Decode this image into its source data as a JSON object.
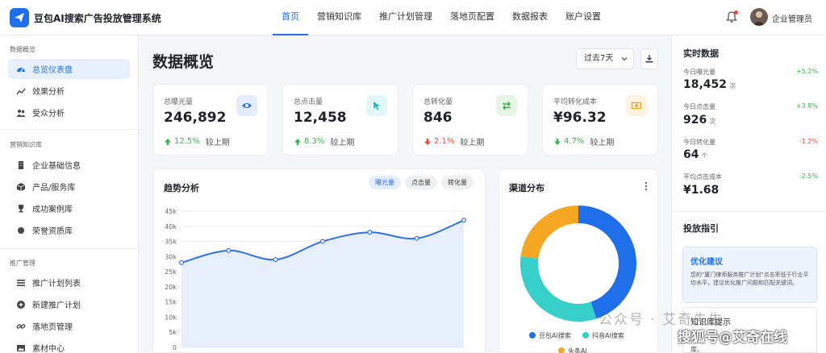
{
  "app": {
    "title": "豆包AI搜索广告投放管理系统"
  },
  "nav": [
    {
      "label": "首页"
    },
    {
      "label": "营销知识库"
    },
    {
      "label": "推广计划管理"
    },
    {
      "label": "落地页配置"
    },
    {
      "label": "数据报表"
    },
    {
      "label": "账户设置"
    }
  ],
  "user": {
    "name": "企业管理员"
  },
  "sidebar": {
    "sections": [
      {
        "title": "数据概览",
        "items": [
          {
            "label": "总览仪表盘",
            "icon": "dashboard-icon"
          },
          {
            "label": "效果分析",
            "icon": "line-chart-icon"
          },
          {
            "label": "受众分析",
            "icon": "users-icon"
          }
        ]
      },
      {
        "title": "营销知识库",
        "items": [
          {
            "label": "企业基础信息",
            "icon": "building-icon"
          },
          {
            "label": "产品/服务库",
            "icon": "box-icon"
          },
          {
            "label": "成功案例库",
            "icon": "trophy-icon"
          },
          {
            "label": "荣誉资质库",
            "icon": "medal-icon"
          }
        ]
      },
      {
        "title": "推广管理",
        "items": [
          {
            "label": "推广计划列表",
            "icon": "list-icon"
          },
          {
            "label": "新建推广计划",
            "icon": "plus-circle-icon"
          },
          {
            "label": "落地页管理",
            "icon": "link-icon"
          },
          {
            "label": "素材中心",
            "icon": "image-icon"
          }
        ]
      }
    ]
  },
  "main": {
    "title": "数据概览",
    "range": "过去7天",
    "kpis": [
      {
        "label": "总曝光量",
        "value": "246,892",
        "change": "12.5%",
        "direction": "up",
        "compare": "较上期",
        "icon": "eye-icon",
        "color": "#1f6feb",
        "bg": "#e3edfd"
      },
      {
        "label": "总点击量",
        "value": "12,458",
        "change": "8.3%",
        "direction": "up",
        "compare": "较上期",
        "icon": "cursor-icon",
        "color": "#22b8c7",
        "bg": "#e2f7f9"
      },
      {
        "label": "总转化量",
        "value": "846",
        "change": "2.1%",
        "direction": "down",
        "compare": "较上期",
        "icon": "exchange-icon",
        "color": "#34b34a",
        "bg": "#e5f6e7"
      },
      {
        "label": "平均转化成本",
        "value": "¥96.32",
        "change": "4.7%",
        "direction": "down-good",
        "compare": "较上期",
        "icon": "money-icon",
        "color": "#e8a317",
        "bg": "#fdf3de"
      }
    ],
    "trend": {
      "title": "趋势分析",
      "tabs": [
        "曝光量",
        "点击量",
        "转化量"
      ]
    },
    "channel": {
      "title": "渠道分布"
    }
  },
  "chart_data": [
    {
      "type": "area",
      "title": "趋势分析",
      "y_ticks": [
        "0",
        "5k",
        "10k",
        "15k",
        "20k",
        "25k",
        "30k",
        "35k",
        "40k",
        "45k"
      ],
      "ylim": [
        0,
        45000
      ],
      "series": [
        {
          "values": [
            28000,
            32000,
            29000,
            35000,
            38000,
            36000,
            42000
          ]
        }
      ],
      "grid": true,
      "color": "#2f6fe8"
    },
    {
      "type": "pie",
      "title": "渠道分布",
      "series": [
        {
          "name": "豆包AI搜索",
          "value": 45,
          "color": "#1f6feb"
        },
        {
          "name": "抖音AI搜索",
          "value": 32,
          "color": "#36cfc9"
        },
        {
          "name": "头条AI",
          "value": 23,
          "color": "#f5a623"
        }
      ],
      "legend": "bottom"
    }
  ],
  "realtime": {
    "title": "实时数据",
    "items": [
      {
        "label": "今日曝光量",
        "value": "18,452",
        "unit": "次",
        "change": "+5.2%",
        "color": "#34b34a"
      },
      {
        "label": "今日点击量",
        "value": "926",
        "unit": "次",
        "change": "+3.8%",
        "color": "#34b34a"
      },
      {
        "label": "今日转化量",
        "value": "64",
        "unit": "个",
        "change": "-1.2%",
        "color": "#f0443a"
      },
      {
        "label": "平均点击成本",
        "value": "¥1.68",
        "unit": "",
        "change": "-2.5%",
        "color": "#34b34a"
      }
    ]
  },
  "guide": {
    "title": "投放指引",
    "advice_title": "优化建议",
    "advice_text": "您的\"厦门律师服务推广计划\"点击率低于行业平均水平，建议优化推广问题和匹配关键词。",
    "tip_title": "知识库提示",
    "tip_text": "度。"
  },
  "watermark": {
    "line1": "公众号 · 艾奇先生",
    "line2": "搜狐号@艾奇在线"
  }
}
